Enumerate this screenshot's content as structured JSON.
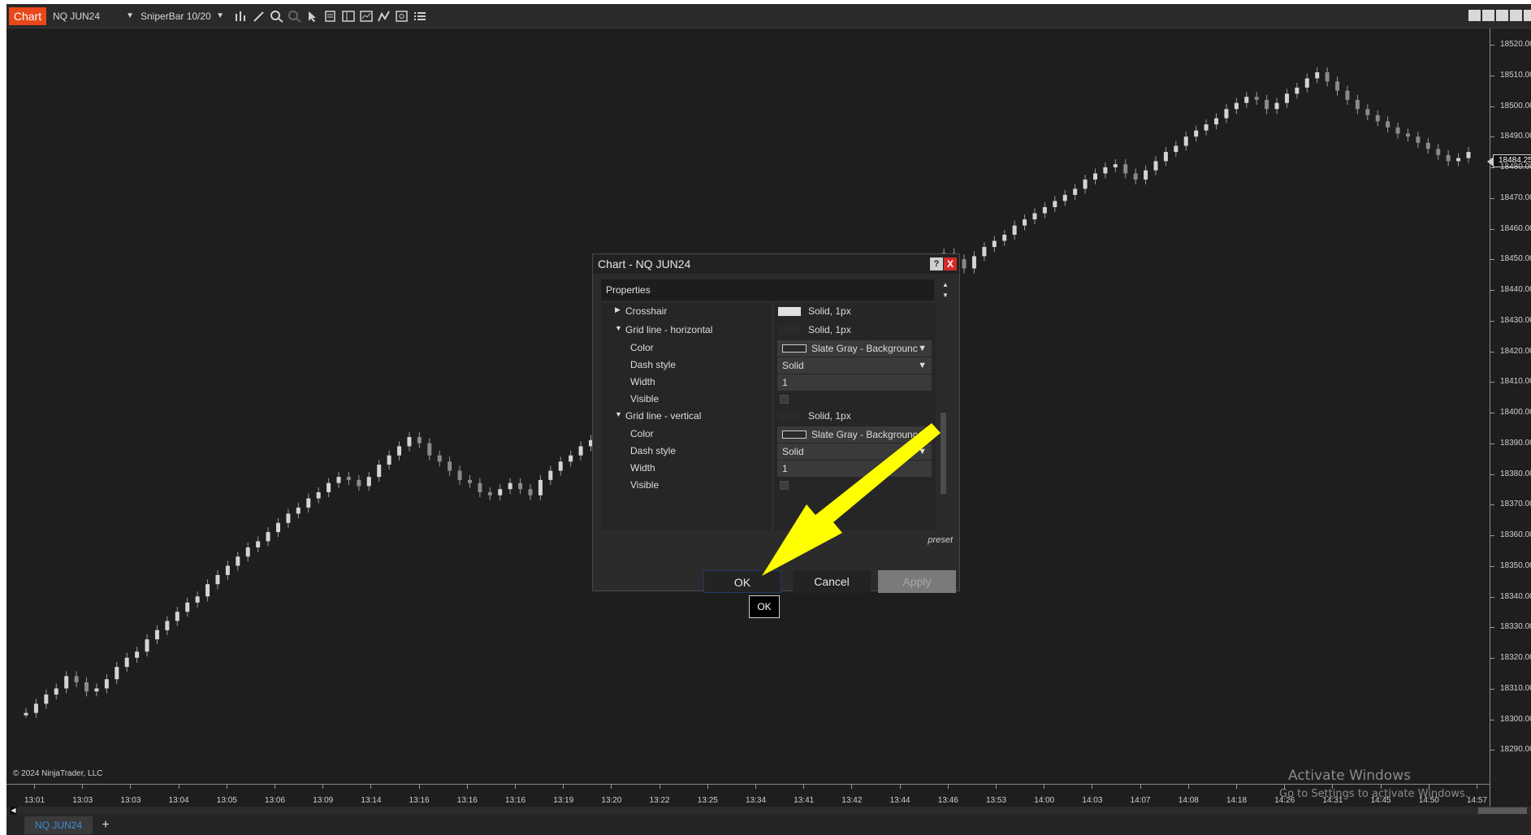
{
  "toolbar": {
    "chart_tab": "Chart",
    "instrument": "NQ JUN24",
    "bar_type": "SniperBar 10/20",
    "icons": [
      "bar-chart-icon",
      "draw-pencil-icon",
      "zoom-in-icon",
      "zoom-out-icon",
      "pointer-icon",
      "data-box-icon",
      "templates-icon",
      "indicators-icon",
      "strategies-icon",
      "properties-icon",
      "list-icon"
    ]
  },
  "price_axis": {
    "labels": [
      "18520.00",
      "18510.00",
      "18500.00",
      "18490.00",
      "18480.00",
      "18470.00",
      "18460.00",
      "18450.00",
      "18440.00",
      "18430.00",
      "18420.00",
      "18410.00",
      "18400.00",
      "18390.00",
      "18380.00",
      "18370.00",
      "18360.00",
      "18350.00",
      "18340.00",
      "18330.00",
      "18320.00",
      "18310.00",
      "18300.00",
      "18290.00"
    ],
    "current_price": "18484.25"
  },
  "time_axis": {
    "labels": [
      "13:01",
      "13:03",
      "13:03",
      "13:04",
      "13:05",
      "13:06",
      "13:09",
      "13:14",
      "13:16",
      "13:16",
      "13:16",
      "13:19",
      "13:20",
      "13:22",
      "13:25",
      "13:34",
      "13:41",
      "13:42",
      "13:44",
      "13:46",
      "13:53",
      "14:00",
      "14:03",
      "14:07",
      "14:08",
      "14:18",
      "14:26",
      "14:31",
      "14:45",
      "14:50",
      "14:57"
    ]
  },
  "copyright": "© 2024 NinjaTrader, LLC",
  "watermark": {
    "line1": "Activate Windows",
    "line2": "Go to Settings to activate Windows."
  },
  "bottom": {
    "instrument_tab": "NQ JUN24",
    "add_tab": "+"
  },
  "dialog": {
    "title": "Chart - NQ JUN24",
    "help": "?",
    "close": "X",
    "section": "Properties",
    "rows": {
      "crosshair": {
        "name": "Crosshair",
        "value": "Solid, 1px"
      },
      "grid_h": {
        "name": "Grid line - horizontal",
        "value": "Solid, 1px"
      },
      "grid_h_color": {
        "name": "Color",
        "value": "Slate Gray - Backgrounc"
      },
      "grid_h_dash": {
        "name": "Dash style",
        "value": "Solid"
      },
      "grid_h_width": {
        "name": "Width",
        "value": "1"
      },
      "grid_h_visible": {
        "name": "Visible"
      },
      "grid_v": {
        "name": "Grid line - vertical",
        "value": "Solid, 1px"
      },
      "grid_v_color": {
        "name": "Color",
        "value": "Slate Gray - Backgrounc"
      },
      "grid_v_dash": {
        "name": "Dash style",
        "value": "Solid"
      },
      "grid_v_width": {
        "name": "Width",
        "value": "1"
      },
      "grid_v_visible": {
        "name": "Visible"
      }
    },
    "preset": "preset",
    "ok": "OK",
    "cancel": "Cancel",
    "apply": "Apply",
    "ok_tooltip": "OK"
  },
  "colors": {
    "chart_tab": "#e8471a",
    "background": "#1e1e1e",
    "candle_up": "#d4d4d4",
    "candle_down": "#8a8a8a",
    "annotation_arrow": "#ffff00",
    "close_button": "#d42a2a"
  },
  "chart_data": {
    "type": "candlestick",
    "series": [
      {
        "values": [
          18302,
          18305,
          18308,
          18310,
          18314,
          18312,
          18309,
          18310,
          18313,
          18317,
          18320,
          18322,
          18326,
          18329,
          18332,
          18335,
          18338,
          18340,
          18344,
          18347,
          18350,
          18353,
          18356,
          18358,
          18361,
          18364,
          18367,
          18369,
          18372,
          18374,
          18377,
          18379,
          18378,
          18376,
          18379,
          18383,
          18386,
          18389,
          18392,
          18390,
          18386,
          18384,
          18381,
          18378,
          18377,
          18374,
          18373,
          18375,
          18377,
          18375,
          18373,
          18378,
          18381,
          18384,
          18386,
          18389,
          18391,
          18390,
          18393,
          18395,
          18397,
          18399,
          18401,
          18403,
          18406,
          18408,
          18410,
          18413,
          18416,
          18419,
          18421,
          18423,
          18425,
          18426,
          18423,
          18426,
          18428,
          18429,
          18431,
          18433,
          18435,
          18437,
          18438,
          18436,
          18433,
          18437,
          18440,
          18442,
          18444,
          18447,
          18449,
          18452,
          18450,
          18447,
          18451,
          18454,
          18456,
          18458,
          18461,
          18463,
          18465,
          18467,
          18469,
          18471,
          18473,
          18476,
          18478,
          18480,
          18481,
          18478,
          18476,
          18479,
          18482,
          18485,
          18487,
          18490,
          18492,
          18494,
          18496,
          18499,
          18501,
          18503,
          18502,
          18499,
          18501,
          18504,
          18506,
          18509,
          18511,
          18508,
          18505,
          18502,
          18499,
          18497,
          18495,
          18493,
          18491,
          18490,
          18488,
          18486,
          18484,
          18482,
          18483,
          18485
        ]
      }
    ]
  }
}
